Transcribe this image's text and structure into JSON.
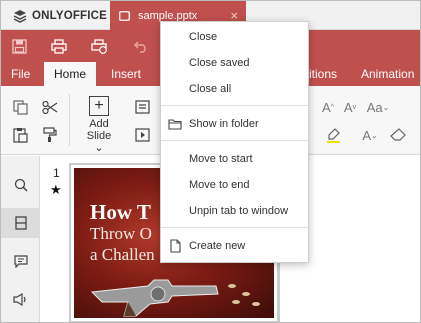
{
  "app": {
    "name": "ONLYOFFICE"
  },
  "document_tab": {
    "name": "sample.pptx",
    "close_glyph": "×"
  },
  "ribbon_tabs": [
    "File",
    "Home",
    "Insert",
    "itions",
    "Animation"
  ],
  "ribbon": {
    "add_slide_line1": "Add",
    "add_slide_line2": "Slide ⌄"
  },
  "slide_panel": {
    "slide_number": "1",
    "star": "★",
    "slide_title": "How T",
    "slide_line2": "Throw O",
    "slide_line3": "a Challen"
  },
  "context_menu": {
    "items": [
      {
        "label": "Close"
      },
      {
        "label": "Close saved"
      },
      {
        "label": "Close all"
      },
      {
        "label": "Show in folder",
        "icon": "folder-icon"
      },
      {
        "label": "Move to start"
      },
      {
        "label": "Move to end"
      },
      {
        "label": "Unpin tab to window"
      },
      {
        "label": "Create new",
        "icon": "new-document-icon"
      }
    ]
  },
  "colors": {
    "accent": "#c0504d",
    "ribbon_bg": "#f7f7f7"
  }
}
